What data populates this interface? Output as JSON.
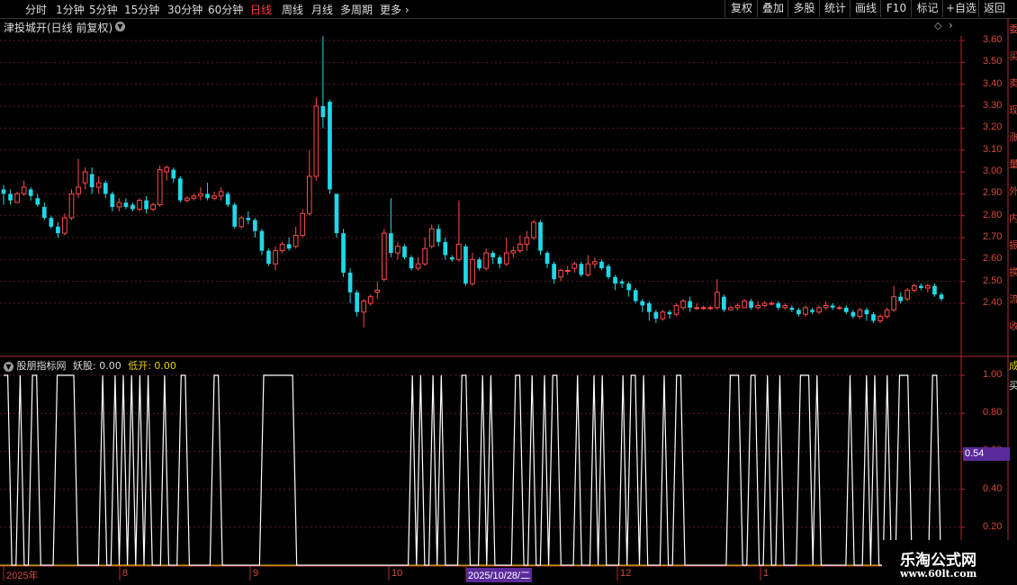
{
  "toolbar": {
    "periods": [
      "分时",
      "1分钟",
      "5分钟",
      "15分钟",
      "30分钟",
      "60分钟",
      "日线",
      "周线",
      "月线",
      "多周期",
      "更多"
    ],
    "active_period": "日线",
    "right_buttons": [
      "复权",
      "叠加",
      "多股",
      "统计",
      "画线",
      "F10",
      "标记",
      "+自选",
      "返回"
    ]
  },
  "chart_header": {
    "title": "津投城开(日线 前复权)"
  },
  "price_axis": {
    "ticks": [
      "3.60",
      "3.50",
      "3.40",
      "3.30",
      "3.20",
      "3.10",
      "3.00",
      "2.90",
      "2.80",
      "2.70",
      "2.60",
      "2.50",
      "2.40"
    ]
  },
  "indicator": {
    "name": "股朋指标网",
    "label1": "妖股: 0.00",
    "label2": "低开: 0.00",
    "ticks": [
      "1.00",
      "0.80",
      "0.60",
      "0.40",
      "0.20"
    ],
    "current_value": "0.54"
  },
  "x_axis": {
    "labels": [
      "2025年",
      "8",
      "9",
      "10",
      "2025/10/28/二",
      "12",
      "1"
    ]
  },
  "side_panel": {
    "chars": "委买卖现涨量外内振换流收",
    "indicator_char": "成买"
  },
  "watermark": {
    "line1": "乐淘公式网",
    "line2": "www.60lt.com"
  },
  "colors": {
    "up": "#ff4a4a",
    "down": "#1fd8e8",
    "axis": "#b02a2a",
    "indicator_line": "#ffffff",
    "zero_line": "#e8d200",
    "marker_bg": "#5a2a9a"
  },
  "chart_data": {
    "type": "candlestick",
    "title": "津投城开(日线 前复权)",
    "price_range": [
      2.2,
      3.65
    ],
    "candles": [
      [
        2.92,
        2.9,
        2.94,
        2.85
      ],
      [
        2.9,
        2.87,
        2.92,
        2.85
      ],
      [
        2.86,
        2.9,
        2.91,
        2.86
      ],
      [
        2.9,
        2.93,
        2.96,
        2.89
      ],
      [
        2.92,
        2.89,
        2.93,
        2.87
      ],
      [
        2.88,
        2.85,
        2.9,
        2.84
      ],
      [
        2.84,
        2.79,
        2.86,
        2.78
      ],
      [
        2.79,
        2.75,
        2.8,
        2.74
      ],
      [
        2.75,
        2.72,
        2.77,
        2.7
      ],
      [
        2.72,
        2.79,
        2.81,
        2.71
      ],
      [
        2.79,
        2.9,
        2.92,
        2.78
      ],
      [
        2.9,
        2.93,
        3.06,
        2.88
      ],
      [
        2.95,
        3.0,
        3.02,
        2.92
      ],
      [
        2.99,
        2.93,
        3.02,
        2.9
      ],
      [
        2.93,
        2.95,
        2.98,
        2.9
      ],
      [
        2.95,
        2.9,
        2.96,
        2.88
      ],
      [
        2.9,
        2.84,
        2.91,
        2.82
      ],
      [
        2.84,
        2.86,
        2.88,
        2.82
      ],
      [
        2.86,
        2.84,
        2.88,
        2.83
      ],
      [
        2.85,
        2.83,
        2.86,
        2.82
      ],
      [
        2.83,
        2.87,
        2.88,
        2.82
      ],
      [
        2.87,
        2.83,
        2.89,
        2.81
      ],
      [
        2.83,
        2.85,
        2.86,
        2.82
      ],
      [
        2.85,
        3.01,
        3.03,
        2.84
      ],
      [
        3.0,
        3.02,
        3.03,
        2.96
      ],
      [
        3.01,
        2.97,
        3.02,
        2.95
      ],
      [
        2.97,
        2.87,
        2.98,
        2.86
      ],
      [
        2.87,
        2.88,
        2.89,
        2.86
      ],
      [
        2.88,
        2.89,
        2.9,
        2.87
      ],
      [
        2.89,
        2.9,
        2.93,
        2.87
      ],
      [
        2.9,
        2.88,
        2.95,
        2.87
      ],
      [
        2.88,
        2.89,
        2.91,
        2.87
      ],
      [
        2.89,
        2.91,
        2.93,
        2.87
      ],
      [
        2.9,
        2.85,
        2.91,
        2.84
      ],
      [
        2.85,
        2.75,
        2.86,
        2.74
      ],
      [
        2.75,
        2.79,
        2.8,
        2.74
      ],
      [
        2.79,
        2.78,
        2.82,
        2.76
      ],
      [
        2.78,
        2.73,
        2.79,
        2.7
      ],
      [
        2.73,
        2.64,
        2.74,
        2.62
      ],
      [
        2.64,
        2.58,
        2.65,
        2.57
      ],
      [
        2.58,
        2.64,
        2.66,
        2.55
      ],
      [
        2.64,
        2.67,
        2.68,
        2.63
      ],
      [
        2.67,
        2.65,
        2.7,
        2.64
      ],
      [
        2.66,
        2.71,
        2.75,
        2.65
      ],
      [
        2.71,
        2.81,
        2.83,
        2.7
      ],
      [
        2.81,
        2.98,
        3.1,
        2.8
      ],
      [
        2.98,
        3.3,
        3.34,
        2.96
      ],
      [
        3.3,
        3.25,
        3.62,
        3.2
      ],
      [
        3.32,
        2.92,
        3.33,
        2.9
      ],
      [
        2.9,
        2.72,
        2.85,
        2.7
      ],
      [
        2.72,
        2.54,
        2.74,
        2.52
      ],
      [
        2.54,
        2.45,
        2.56,
        2.4
      ],
      [
        2.45,
        2.36,
        2.46,
        2.34
      ],
      [
        2.36,
        2.41,
        2.42,
        2.29
      ],
      [
        2.4,
        2.43,
        2.44,
        2.39
      ],
      [
        2.45,
        2.46,
        2.5,
        2.42
      ],
      [
        2.51,
        2.72,
        2.74,
        2.5
      ],
      [
        2.72,
        2.63,
        2.88,
        2.61
      ],
      [
        2.63,
        2.66,
        2.68,
        2.6
      ],
      [
        2.66,
        2.61,
        2.67,
        2.6
      ],
      [
        2.61,
        2.56,
        2.62,
        2.55
      ],
      [
        2.56,
        2.58,
        2.61,
        2.55
      ],
      [
        2.58,
        2.65,
        2.7,
        2.57
      ],
      [
        2.66,
        2.74,
        2.76,
        2.65
      ],
      [
        2.74,
        2.68,
        2.76,
        2.66
      ],
      [
        2.68,
        2.62,
        2.7,
        2.6
      ],
      [
        2.61,
        2.6,
        2.62,
        2.59
      ],
      [
        2.6,
        2.67,
        2.87,
        2.59
      ],
      [
        2.66,
        2.49,
        2.67,
        2.48
      ],
      [
        2.49,
        2.6,
        2.63,
        2.48
      ],
      [
        2.6,
        2.56,
        2.61,
        2.55
      ],
      [
        2.56,
        2.63,
        2.65,
        2.55
      ],
      [
        2.63,
        2.61,
        2.64,
        2.58
      ],
      [
        2.61,
        2.58,
        2.62,
        2.56
      ],
      [
        2.58,
        2.63,
        2.7,
        2.57
      ],
      [
        2.63,
        2.64,
        2.66,
        2.61
      ],
      [
        2.64,
        2.67,
        2.71,
        2.63
      ],
      [
        2.67,
        2.7,
        2.73,
        2.64
      ],
      [
        2.7,
        2.77,
        2.78,
        2.69
      ],
      [
        2.77,
        2.64,
        2.78,
        2.62
      ],
      [
        2.63,
        2.58,
        2.64,
        2.56
      ],
      [
        2.58,
        2.51,
        2.59,
        2.49
      ],
      [
        2.52,
        2.55,
        2.56,
        2.5
      ],
      [
        2.55,
        2.55,
        2.57,
        2.53
      ],
      [
        2.56,
        2.58,
        2.59,
        2.54
      ],
      [
        2.58,
        2.53,
        2.59,
        2.52
      ],
      [
        2.53,
        2.58,
        2.62,
        2.52
      ],
      [
        2.58,
        2.59,
        2.61,
        2.56
      ],
      [
        2.59,
        2.56,
        2.6,
        2.55
      ],
      [
        2.57,
        2.52,
        2.58,
        2.51
      ],
      [
        2.52,
        2.49,
        2.53,
        2.46
      ],
      [
        2.5,
        2.49,
        2.51,
        2.47
      ],
      [
        2.49,
        2.46,
        2.5,
        2.43
      ],
      [
        2.46,
        2.41,
        2.47,
        2.4
      ],
      [
        2.41,
        2.39,
        2.42,
        2.36
      ],
      [
        2.4,
        2.36,
        2.41,
        2.32
      ],
      [
        2.36,
        2.33,
        2.37,
        2.31
      ],
      [
        2.33,
        2.36,
        2.37,
        2.32
      ],
      [
        2.36,
        2.35,
        2.37,
        2.33
      ],
      [
        2.35,
        2.39,
        2.4,
        2.34
      ],
      [
        2.38,
        2.41,
        2.42,
        2.37
      ],
      [
        2.41,
        2.38,
        2.43,
        2.36
      ],
      [
        2.38,
        2.38,
        2.4,
        2.37
      ],
      [
        2.38,
        2.38,
        2.39,
        2.37
      ],
      [
        2.38,
        2.38,
        2.39,
        2.37
      ],
      [
        2.38,
        2.45,
        2.51,
        2.37
      ],
      [
        2.43,
        2.37,
        2.44,
        2.36
      ],
      [
        2.37,
        2.38,
        2.39,
        2.37
      ],
      [
        2.38,
        2.39,
        2.4,
        2.37
      ],
      [
        2.38,
        2.41,
        2.42,
        2.38
      ],
      [
        2.41,
        2.38,
        2.42,
        2.37
      ],
      [
        2.38,
        2.39,
        2.41,
        2.37
      ],
      [
        2.39,
        2.4,
        2.41,
        2.38
      ],
      [
        2.4,
        2.4,
        2.41,
        2.39
      ],
      [
        2.4,
        2.38,
        2.41,
        2.37
      ],
      [
        2.38,
        2.39,
        2.4,
        2.37
      ],
      [
        2.38,
        2.37,
        2.39,
        2.36
      ],
      [
        2.37,
        2.35,
        2.38,
        2.34
      ],
      [
        2.35,
        2.38,
        2.39,
        2.34
      ],
      [
        2.37,
        2.36,
        2.38,
        2.35
      ],
      [
        2.36,
        2.38,
        2.39,
        2.35
      ],
      [
        2.38,
        2.39,
        2.41,
        2.37
      ],
      [
        2.39,
        2.38,
        2.4,
        2.37
      ],
      [
        2.38,
        2.38,
        2.39,
        2.37
      ],
      [
        2.38,
        2.36,
        2.39,
        2.35
      ],
      [
        2.36,
        2.34,
        2.37,
        2.33
      ],
      [
        2.34,
        2.37,
        2.38,
        2.33
      ],
      [
        2.37,
        2.35,
        2.38,
        2.32
      ],
      [
        2.35,
        2.32,
        2.36,
        2.31
      ],
      [
        2.32,
        2.34,
        2.35,
        2.31
      ],
      [
        2.34,
        2.37,
        2.38,
        2.33
      ],
      [
        2.37,
        2.43,
        2.48,
        2.36
      ],
      [
        2.43,
        2.41,
        2.45,
        2.4
      ],
      [
        2.42,
        2.46,
        2.47,
        2.41
      ],
      [
        2.46,
        2.48,
        2.49,
        2.45
      ],
      [
        2.48,
        2.47,
        2.49,
        2.46
      ],
      [
        2.47,
        2.48,
        2.49,
        2.45
      ],
      [
        2.48,
        2.44,
        2.49,
        2.43
      ],
      [
        2.44,
        2.42,
        2.45,
        2.41
      ]
    ],
    "indicator_series": [
      1,
      1,
      0,
      0,
      1,
      0,
      0,
      1,
      1,
      0,
      0,
      0,
      0,
      1,
      1,
      1,
      1,
      1,
      0,
      0,
      0,
      0,
      0,
      0,
      1,
      0,
      0,
      1,
      0,
      1,
      0,
      1,
      0,
      1,
      0,
      1,
      0,
      0,
      0,
      1,
      0,
      0,
      0,
      1,
      1,
      0,
      0,
      0,
      0,
      0,
      0,
      1,
      1,
      0,
      0,
      0,
      0,
      0,
      0,
      0,
      0,
      0,
      0,
      1,
      1,
      1,
      1,
      1,
      1,
      1,
      1,
      0,
      0,
      0,
      0,
      0,
      0,
      0,
      0,
      0,
      0,
      0,
      0,
      0,
      0,
      0,
      0,
      0,
      0,
      0,
      0,
      0,
      0,
      0,
      0,
      0,
      0,
      0,
      0,
      1,
      0,
      1,
      0,
      0,
      1,
      0,
      1,
      0,
      0,
      0,
      0,
      1,
      1,
      0,
      0,
      0,
      1,
      0,
      1,
      0,
      0,
      0,
      0,
      0,
      1,
      1,
      0,
      0,
      1,
      0,
      0,
      1,
      0,
      1,
      1,
      0,
      0,
      0,
      0,
      1,
      0,
      0,
      0,
      1,
      0,
      1,
      0,
      0,
      0,
      0,
      1,
      0,
      1,
      1,
      0,
      1,
      0,
      0,
      0,
      0,
      1,
      0,
      0,
      1,
      1,
      0,
      0,
      0,
      0,
      0,
      0,
      0,
      0,
      0,
      0,
      0,
      1,
      1,
      1,
      0,
      0,
      1,
      1,
      0,
      0,
      1,
      0,
      0,
      1,
      0,
      0,
      0,
      0,
      1,
      1,
      1,
      0,
      1,
      0,
      0,
      0,
      0,
      0,
      0,
      0,
      1,
      0,
      0,
      0,
      1,
      0,
      1,
      0,
      0,
      1,
      0,
      0,
      1,
      1,
      1,
      0,
      0,
      0,
      0,
      0,
      1,
      1,
      0,
      0
    ]
  }
}
